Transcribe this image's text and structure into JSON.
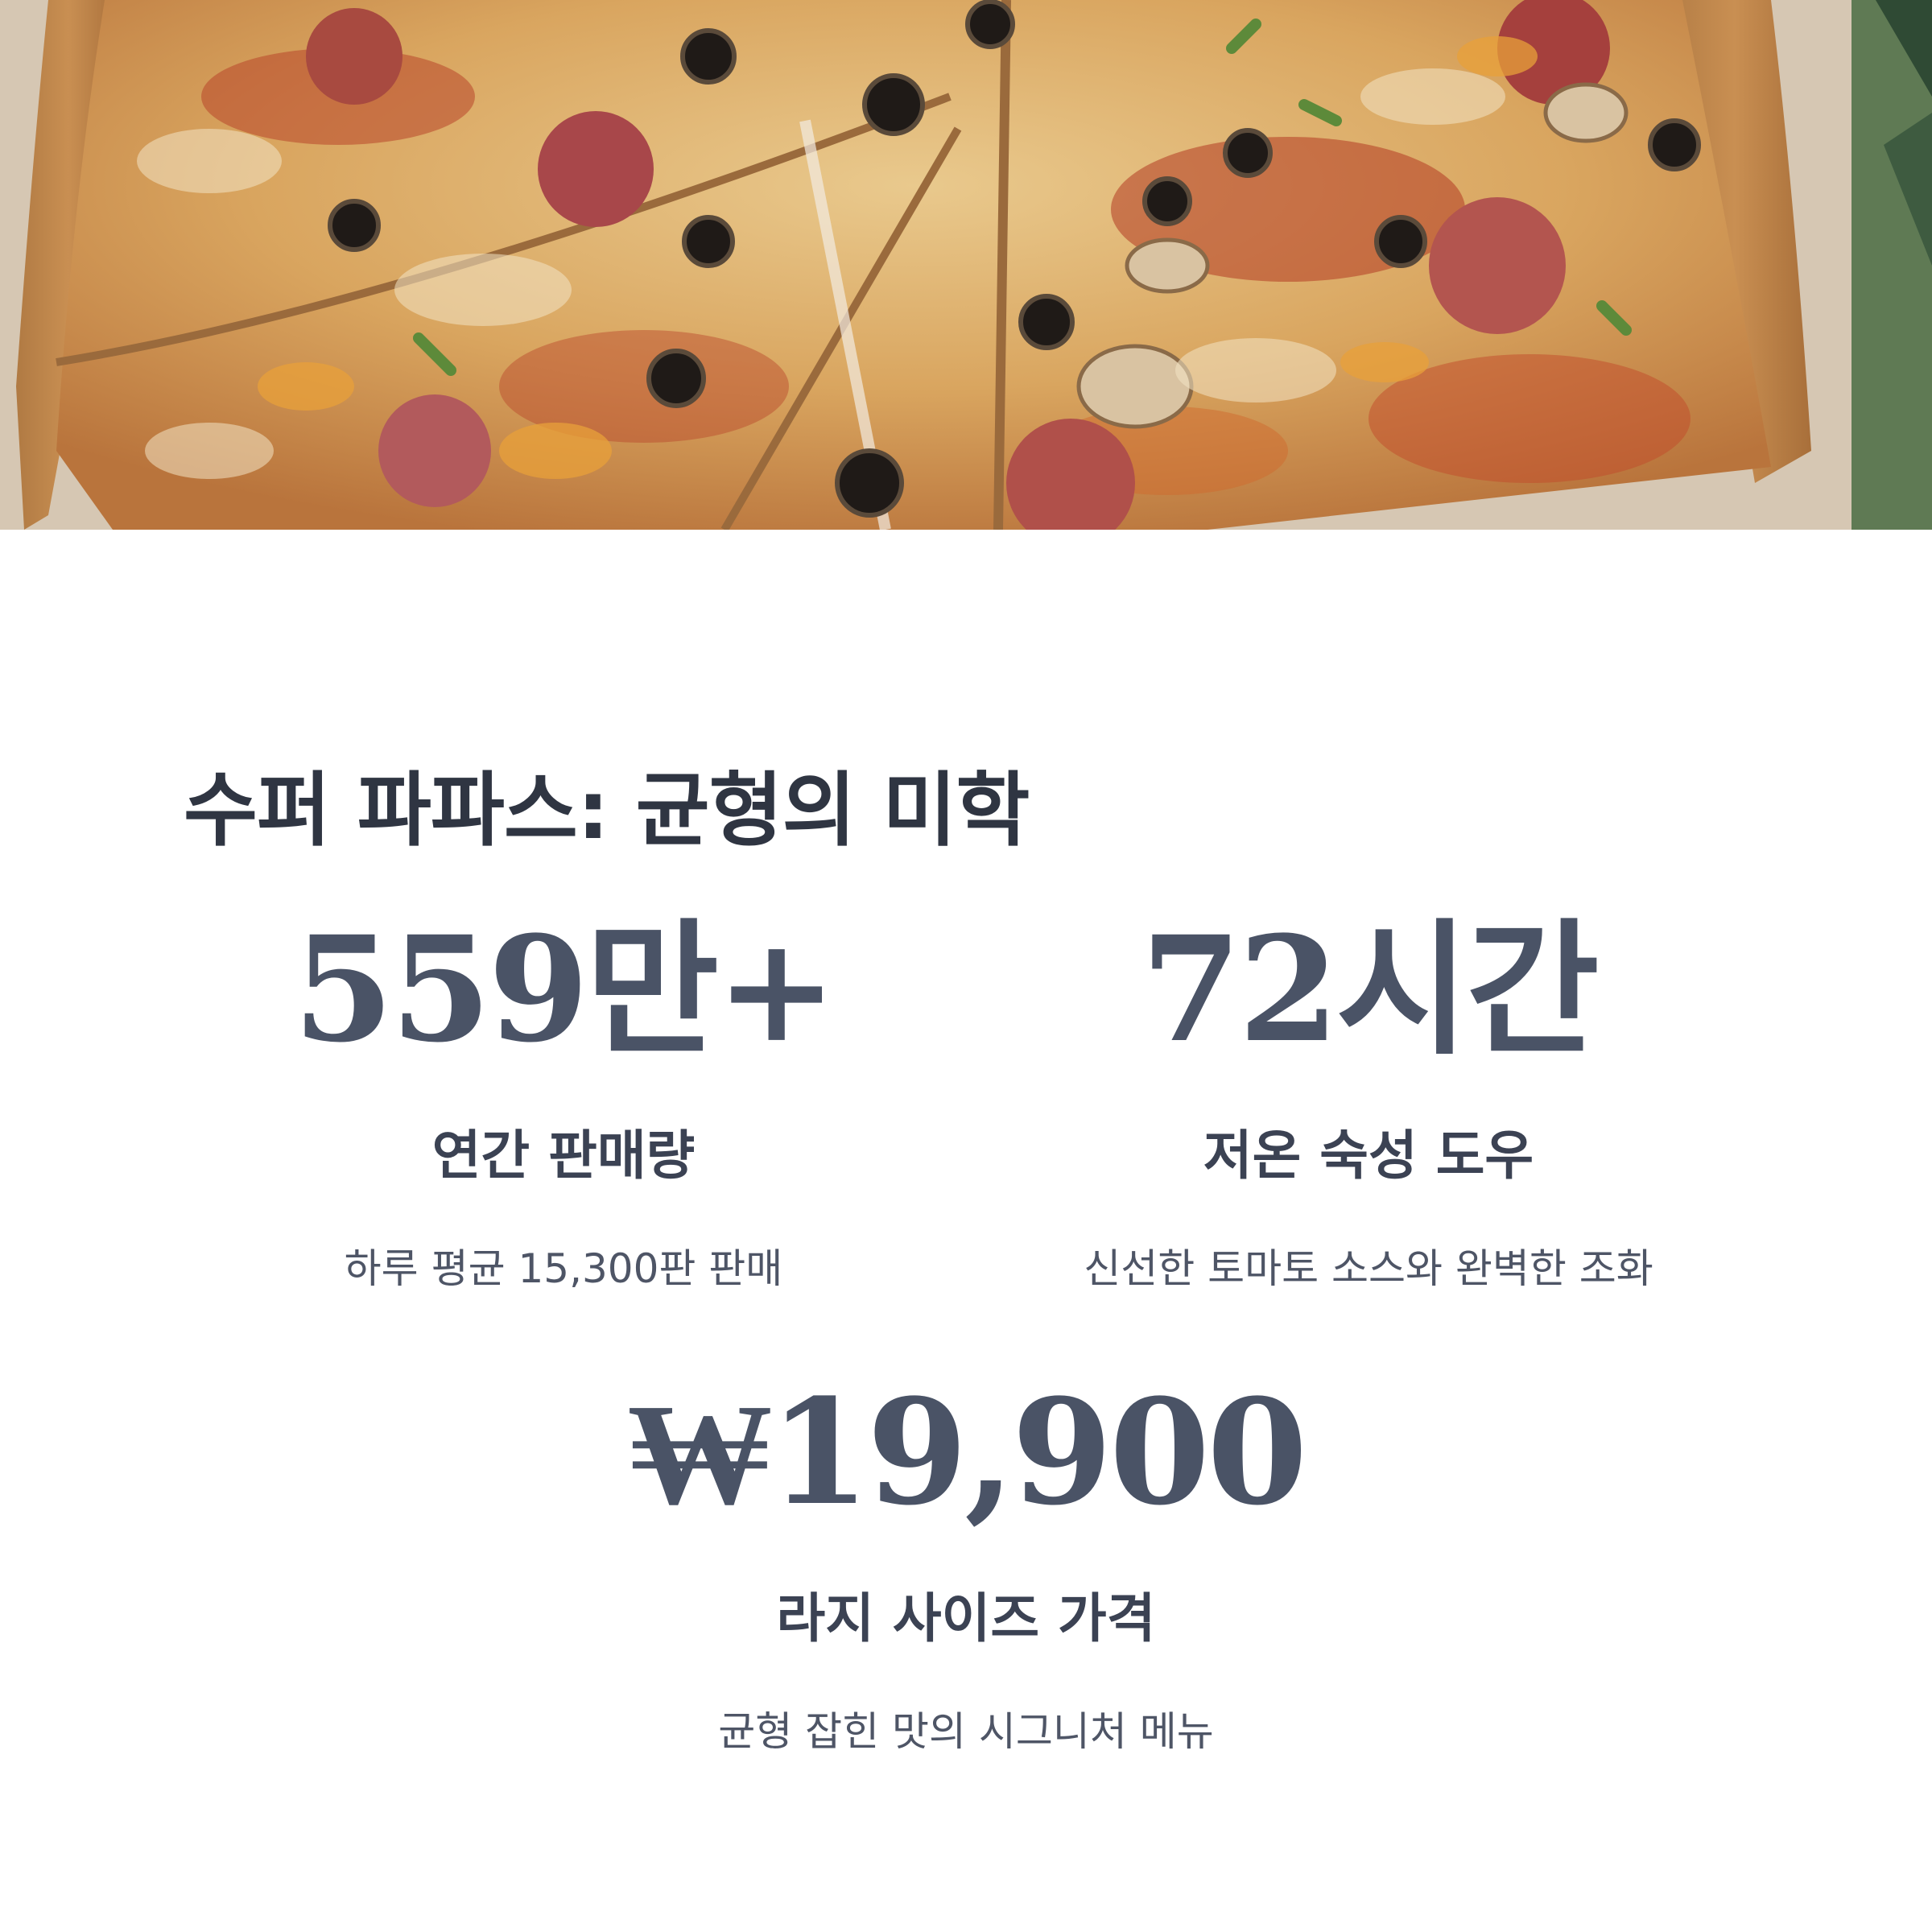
{
  "title": "수퍼 파파스: 균형의 미학",
  "stats": [
    {
      "value": "559만+",
      "label": "연간 판매량",
      "description": "하루 평균 15,300판 판매"
    },
    {
      "value": "72시간",
      "label": "저온 숙성 도우",
      "description": "신선한 토마토 소스와 완벽한 조화"
    },
    {
      "value": "₩19,900",
      "label": "라지 사이즈 가격",
      "description": "균형 잡힌 맛의 시그니처 메뉴"
    }
  ],
  "colors": {
    "heading": "#2f3542",
    "stat_value": "#4a5366",
    "label": "#3b4253",
    "description": "#4e5566",
    "background": "#ffffff"
  }
}
